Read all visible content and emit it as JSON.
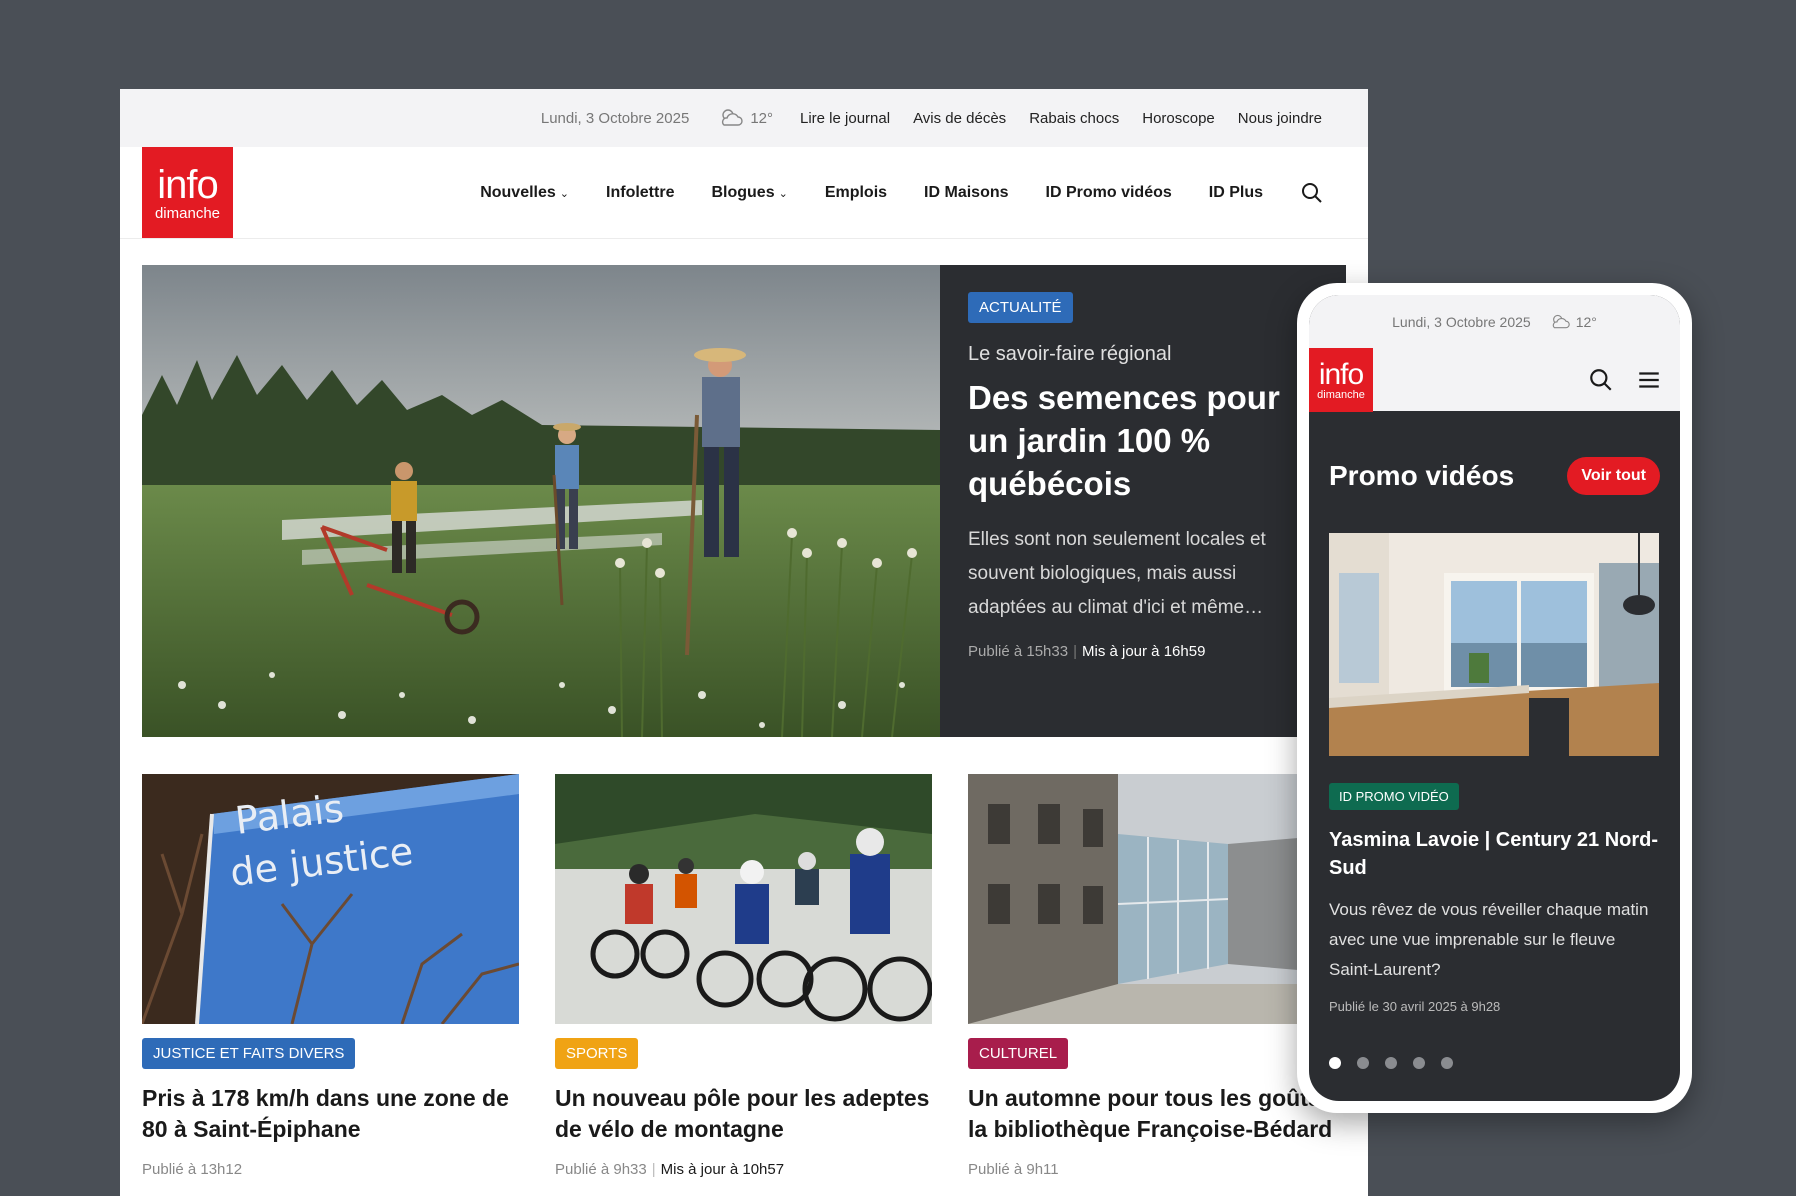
{
  "desktop": {
    "topbar": {
      "date": "Lundi, 3 Octobre 2025",
      "temperature": "12°",
      "links": [
        "Lire le journal",
        "Avis de décès",
        "Rabais chocs",
        "Horoscope",
        "Nous joindre"
      ]
    },
    "logo": {
      "line1": "info",
      "line2": "dimanche"
    },
    "nav": [
      "Nouvelles",
      "Infolettre",
      "Blogues",
      "Emplois",
      "ID Maisons",
      "ID Promo vidéos",
      "ID Plus"
    ],
    "hero": {
      "tag": "ACTUALITÉ",
      "kicker": "Le savoir-faire régional",
      "title": "Des semences pour un jardin 100 % québécois",
      "excerpt": "Elles sont non seulement locales et souvent biologiques, mais aussi adaptées au climat d'ici et même…",
      "published": "Publié à 15h33",
      "updated": "Mis à jour à 16h59"
    },
    "cards": [
      {
        "tag": "JUSTICE ET FAITS DIVERS",
        "title": "Pris à 178 km/h dans une zone de 80 à Saint-Épiphane",
        "published": "Publié à 13h12",
        "updated": "",
        "image_text_1": "Palais",
        "image_text_2": "de justice"
      },
      {
        "tag": "SPORTS",
        "title": "Un nouveau pôle pour les adeptes de vélo de montagne",
        "published": "Publié à 9h33",
        "updated": "Mis à jour à 10h57"
      },
      {
        "tag": "CULTUREL",
        "title": "Un automne pour tous les goûts à la bibliothèque Françoise-Bédard",
        "published": "Publié à 9h11",
        "updated": ""
      }
    ]
  },
  "phone": {
    "date": "Lundi, 3 Octobre 2025",
    "temperature": "12°",
    "logo": {
      "line1": "info",
      "line2": "dimanche"
    },
    "section_title": "Promo vidéos",
    "see_all": "Voir tout",
    "tag": "ID PROMO VIDÉO",
    "title": "Yasmina Lavoie | Century 21 Nord-Sud",
    "excerpt": "Vous rêvez de vous réveiller chaque matin avec une vue imprenable sur le fleuve Saint-Laurent?",
    "published": "Publié le 30 avril 2025 à 9h28",
    "carousel_count": 5,
    "carousel_active": 1
  },
  "colors": {
    "brand_red": "#e31b23",
    "actu_blue": "#2e6bb8",
    "sports_orange": "#f0a314",
    "culturel_crimson": "#a81d4c",
    "promo_green": "#0e6b50",
    "dark_panel": "#2b2d31"
  },
  "icons": [
    "cloud-icon",
    "search-icon",
    "chevron-down-icon",
    "hamburger-menu-icon"
  ]
}
